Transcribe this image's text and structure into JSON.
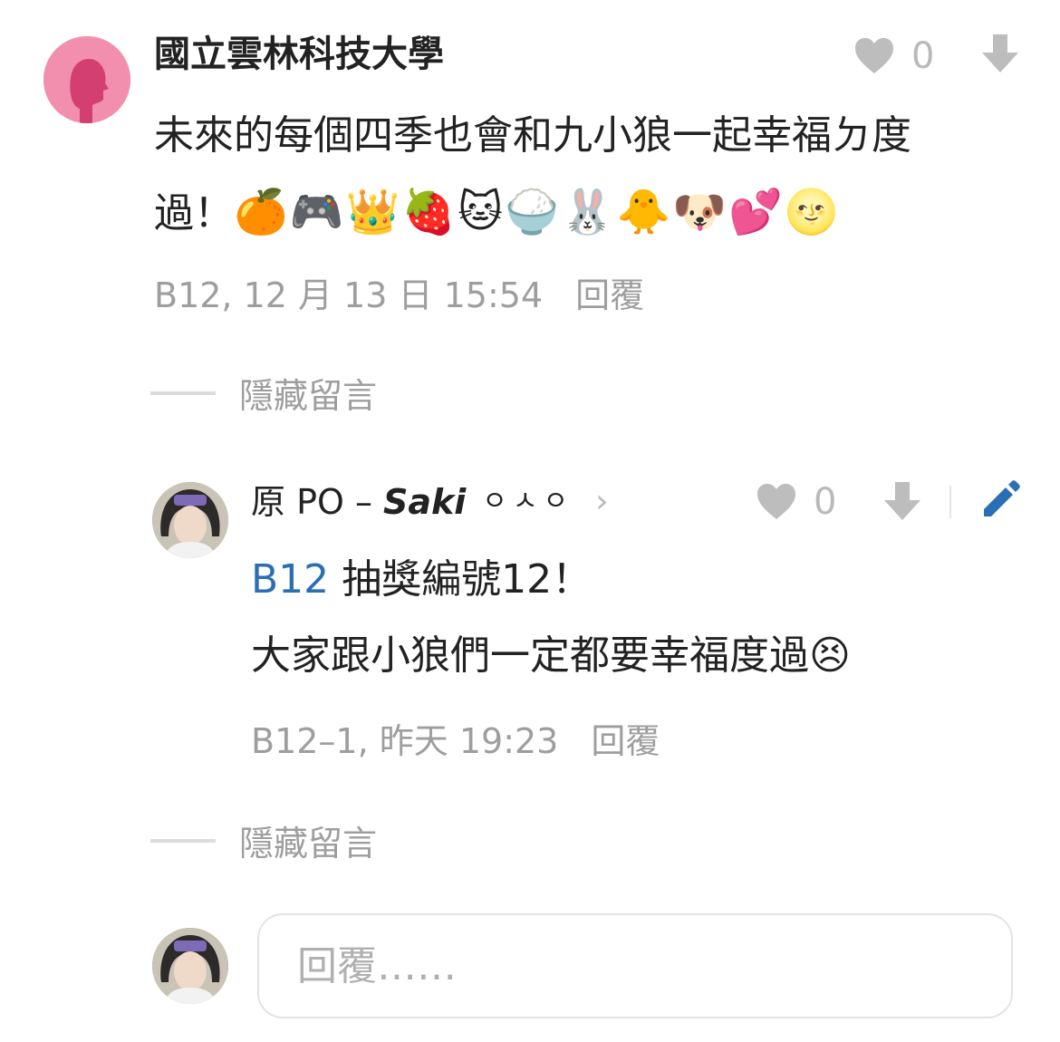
{
  "comment": {
    "author": "國立雲林科技大學",
    "likes": "0",
    "text_line1": "未來的每個四季也會和九小狼一起幸福ㄉ度",
    "text_line2": "過！",
    "emojis": "🍊🎮👑🍓🐱🍚🐰🐥🐶💕🌝",
    "floor_time": "B12, 12 月 13 日 15:54",
    "reply_label": "回覆",
    "hide_label": "隱藏留言"
  },
  "reply": {
    "author_prefix": "原 PO –",
    "author_name": "Saki",
    "author_suffix": "ㅇㅅㅇ",
    "likes": "0",
    "mention": "B12",
    "text_line1": "抽獎編號12！",
    "text_line2": "大家跟小狼們一定都要幸福度過😣",
    "floor_time": "B12–1, 昨天 19:23",
    "reply_label": "回覆",
    "hide_label": "隱藏留言"
  },
  "reply_box": {
    "placeholder": "回覆……"
  },
  "colors": {
    "accent_blue": "#2a6fb4",
    "muted_gray": "#9e9e9e",
    "avatar_pink": "#f28fae"
  }
}
